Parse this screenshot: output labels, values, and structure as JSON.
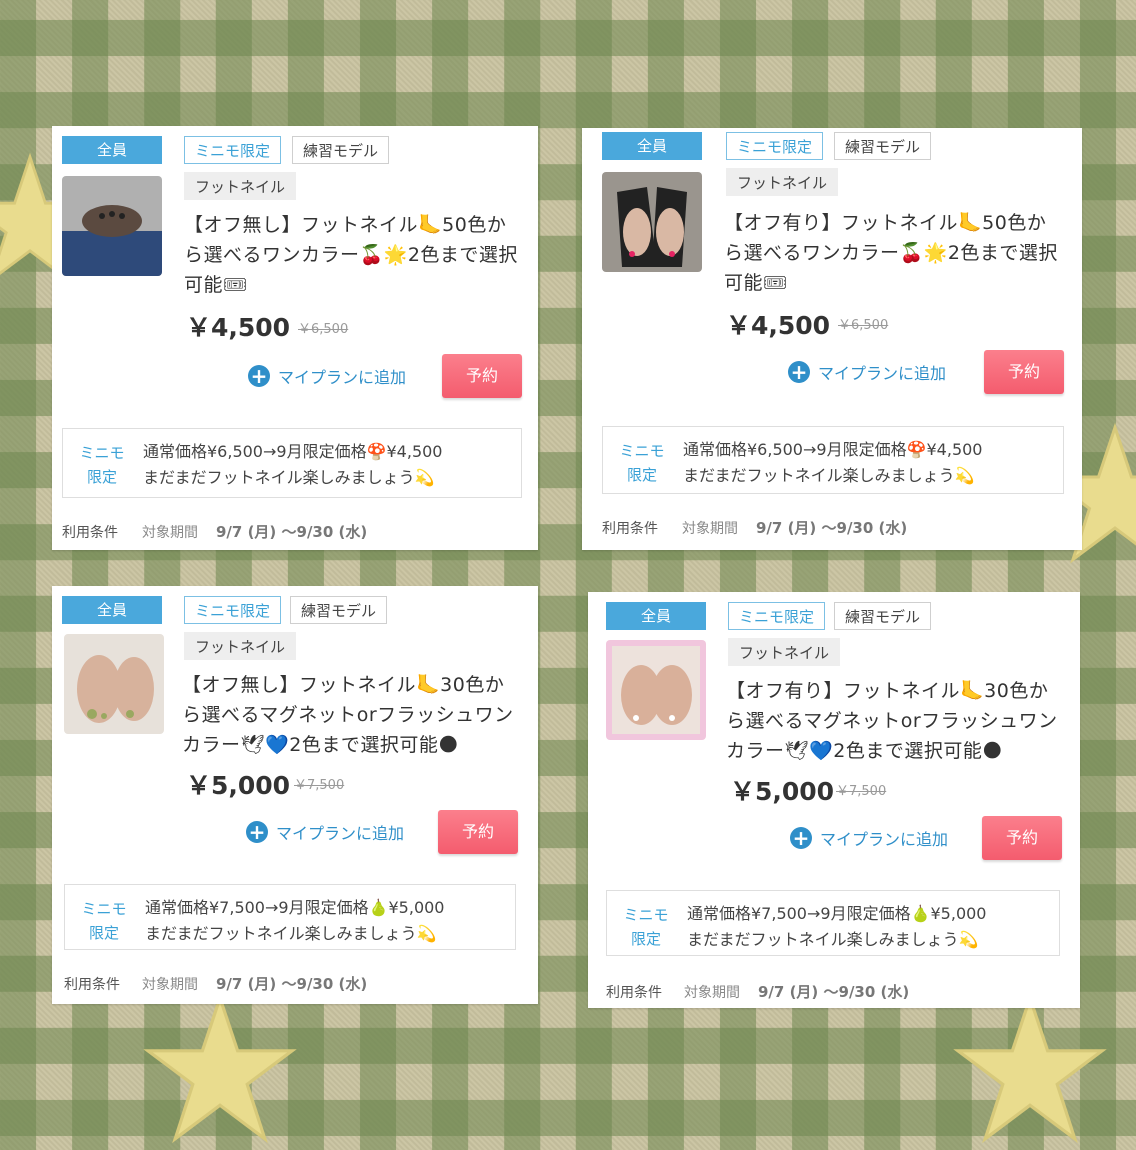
{
  "cards": [
    {
      "badge": "全員",
      "tag_limited": "ミニモ限定",
      "tag_practice": "練習モデル",
      "tag_category": "フットネイル",
      "title": "【オフ無し】フットネイル🦶50色から選べるワンカラー🍒🌟2色まで選択可能🎟",
      "price": "￥4,500",
      "old_price": "￥6,500",
      "add_plan": "マイプランに追加",
      "reserve": "予約",
      "note_label": "ミニモ限定",
      "note_line1": "通常価格¥6,500→9月限定価格🍄¥4,500",
      "note_line2": "まだまだフットネイル楽しみましょう💫",
      "terms": "利用条件",
      "period_label": "対象期間",
      "period": "9/7 (月) ～9/30 (水)",
      "thumb_color": "#6a6a6a"
    },
    {
      "badge": "全員",
      "tag_limited": "ミニモ限定",
      "tag_practice": "練習モデル",
      "tag_category": "フットネイル",
      "title": "【オフ有り】フットネイル🦶50色から選べるワンカラー🍒🌟2色まで選択可能🎟",
      "price": "￥4,500",
      "old_price": "￥6,500",
      "add_plan": "マイプランに追加",
      "reserve": "予約",
      "note_label": "ミニモ限定",
      "note_line1": "通常価格¥6,500→9月限定価格🍄¥4,500",
      "note_line2": "まだまだフットネイル楽しみましょう💫",
      "terms": "利用条件",
      "period_label": "対象期間",
      "period": "9/7 (月) ～9/30 (水)",
      "thumb_color": "#3a3a3a"
    },
    {
      "badge": "全員",
      "tag_limited": "ミニモ限定",
      "tag_practice": "練習モデル",
      "tag_category": "フットネイル",
      "title": "【オフ無し】フットネイル🦶30色から選べるマグネットorフラッシュワンカラー🕊💙2色まで選択可能🌑",
      "price": "￥5,000",
      "old_price": "￥7,500",
      "add_plan": "マイプランに追加",
      "reserve": "予約",
      "note_label": "ミニモ限定",
      "note_line1": "通常価格¥7,500→9月限定価格🍐¥5,000",
      "note_line2": "まだまだフットネイル楽しみましょう💫",
      "terms": "利用条件",
      "period_label": "対象期間",
      "period": "9/7 (月) ～9/30 (水)",
      "thumb_color": "#b9a79a"
    },
    {
      "badge": "全員",
      "tag_limited": "ミニモ限定",
      "tag_practice": "練習モデル",
      "tag_category": "フットネイル",
      "title": "【オフ有り】フットネイル🦶30色から選べるマグネットorフラッシュワンカラー🕊💙2色まで選択可能🌑",
      "price": "￥5,000",
      "old_price": "￥7,500",
      "add_plan": "マイプランに追加",
      "reserve": "予約",
      "note_label": "ミニモ限定",
      "note_line1": "通常価格¥7,500→9月限定価格🍐¥5,000",
      "note_line2": "まだまだフットネイル楽しみましょう💫",
      "terms": "利用条件",
      "period_label": "対象期間",
      "period": "9/7 (月) ～9/30 (水)",
      "thumb_color": "#e8c9d8"
    }
  ]
}
